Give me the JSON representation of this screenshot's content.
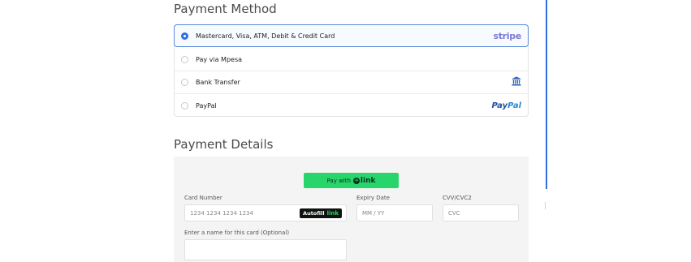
{
  "payment_method": {
    "title": "Payment Method",
    "options": [
      {
        "label": "Mastercard, Visa, ATM, Debit & Credit Card",
        "selected": true,
        "logo": "stripe",
        "logo_text": "stripe"
      },
      {
        "label": "Pay via Mpesa",
        "selected": false,
        "logo": "",
        "logo_text": ""
      },
      {
        "label": "Bank Transfer",
        "selected": false,
        "logo": "bank-icon",
        "logo_text": ""
      },
      {
        "label": "PayPal",
        "selected": false,
        "logo": "paypal",
        "logo_text_pay": "Pay",
        "logo_text_pal": "Pal"
      }
    ]
  },
  "payment_details": {
    "title": "Payment Details",
    "pay_with_link": {
      "prefix": "Pay with",
      "link_word": "link"
    },
    "card_number": {
      "label": "Card Number",
      "placeholder": "1234 1234 1234 1234"
    },
    "autofill": {
      "label": "Autofill",
      "link_word": "link"
    },
    "expiry": {
      "label": "Expiry Date",
      "placeholder": "MM / YY"
    },
    "cvv": {
      "label": "CVV/CVC2",
      "placeholder": "CVC"
    },
    "card_name": {
      "label": "Enter a name for this card (Optional)",
      "placeholder": ""
    }
  },
  "colors": {
    "accent_blue": "#2f6fe0",
    "link_green": "#27d56b",
    "stripe_purple": "#7a7ad6",
    "paypal_dark": "#1f4ea1",
    "paypal_light": "#2a8ad5"
  }
}
